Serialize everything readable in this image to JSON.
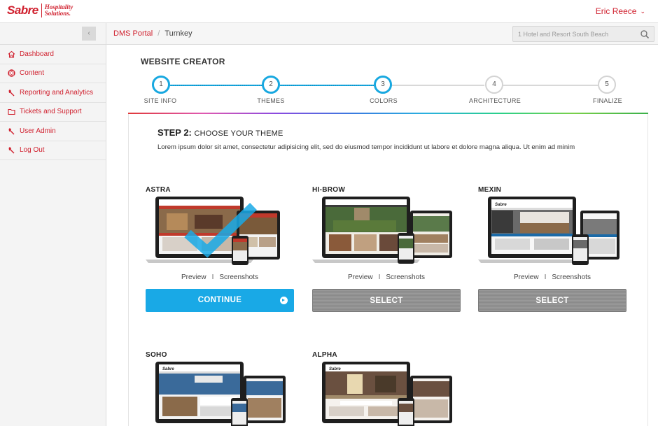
{
  "brand": {
    "name": "Sabre",
    "sub_line1": "Hospitality",
    "sub_line2": "Solutions."
  },
  "user": {
    "name": "Eric Reece"
  },
  "sidebar": {
    "items": [
      {
        "label": "Dashboard",
        "icon": "home-icon"
      },
      {
        "label": "Content",
        "icon": "lifebuoy-icon"
      },
      {
        "label": "Reporting and Analytics",
        "icon": "wrench-icon"
      },
      {
        "label": "Tickets and Support",
        "icon": "folder-icon"
      },
      {
        "label": "User Admin",
        "icon": "wrench-icon"
      },
      {
        "label": "Log Out",
        "icon": "wrench-icon"
      }
    ]
  },
  "breadcrumb": {
    "root": "DMS Portal",
    "separator": "/",
    "current": "Turnkey"
  },
  "search": {
    "placeholder": "1 Hotel and Resort South Beach"
  },
  "page": {
    "title": "WEBSITE CREATOR"
  },
  "stepper": {
    "steps": [
      {
        "number": "1",
        "label": "SITE INFO",
        "active": true
      },
      {
        "number": "2",
        "label": "THEMES",
        "active": true
      },
      {
        "number": "3",
        "label": "COLORS",
        "active": true
      },
      {
        "number": "4",
        "label": "ARCHITECTURE",
        "active": false
      },
      {
        "number": "5",
        "label": "FINALIZE",
        "active": false
      }
    ]
  },
  "step": {
    "heading_bold": "STEP 2:",
    "heading_rest": "CHOOSE YOUR THEME",
    "description": "Lorem ipsum dolor sit amet, consectetur adipisicing elit, sed do eiusmod tempor incididunt ut labore et dolore magna aliqua. Ut enim ad minim"
  },
  "themes": [
    {
      "name": "ASTRA",
      "preview": "Preview",
      "screenshots": "Screenshots",
      "sep": "I",
      "button": "CONTINUE",
      "selected": true
    },
    {
      "name": "HI-BROW",
      "preview": "Preview",
      "screenshots": "Screenshots",
      "sep": "I",
      "button": "SELECT",
      "selected": false
    },
    {
      "name": "MEXIN",
      "preview": "Preview",
      "screenshots": "Screenshots",
      "sep": "I",
      "button": "SELECT",
      "selected": false
    },
    {
      "name": "SOHO",
      "selected": false
    },
    {
      "name": "ALPHA",
      "selected": false
    }
  ],
  "colors": {
    "accent": "#d0202e",
    "primary_blue": "#19a9e6",
    "inactive": "#d3d3d3"
  }
}
